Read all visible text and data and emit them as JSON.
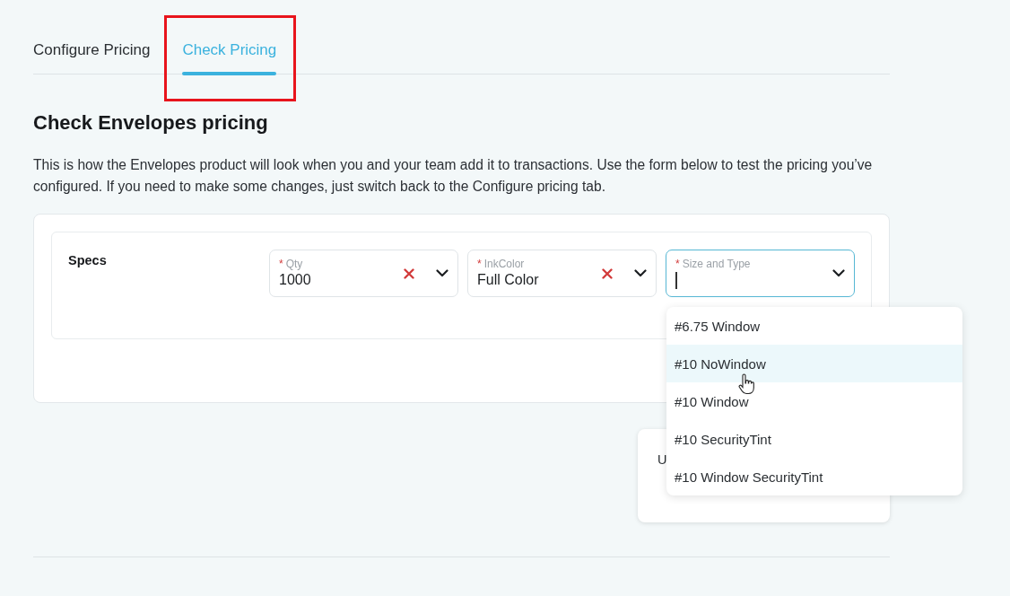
{
  "tabs": [
    {
      "label": "Configure Pricing",
      "selected": false,
      "highlighted": false
    },
    {
      "label": "Check Pricing",
      "selected": true,
      "highlighted": true
    }
  ],
  "heading": "Check Envelopes pricing",
  "description": "This is how the Envelopes product will look when you and your team add it to transactions. Use the form below to test the pricing you’ve configured. If you need to make some changes, just switch back to the Configure pricing tab.",
  "specs": {
    "label": "Specs",
    "fields": [
      {
        "required_mark": "*",
        "label": "Qty",
        "value": "1000",
        "clearable": true,
        "focused": false
      },
      {
        "required_mark": "*",
        "label": "InkColor",
        "value": "Full Color",
        "clearable": true,
        "focused": false
      },
      {
        "required_mark": "*",
        "label": "Size and Type",
        "focused": true,
        "expanded": true,
        "options": [
          {
            "label": "#6.75 Window",
            "selected": false
          },
          {
            "label": "#10 NoWindow",
            "selected": true
          },
          {
            "label": "#10 Window",
            "selected": false
          },
          {
            "label": "#10 SecurityTint",
            "selected": false
          },
          {
            "label": "#10 Window SecurityTint",
            "selected": false
          }
        ]
      }
    ]
  },
  "price_card": {
    "label_fragment": "U"
  }
}
